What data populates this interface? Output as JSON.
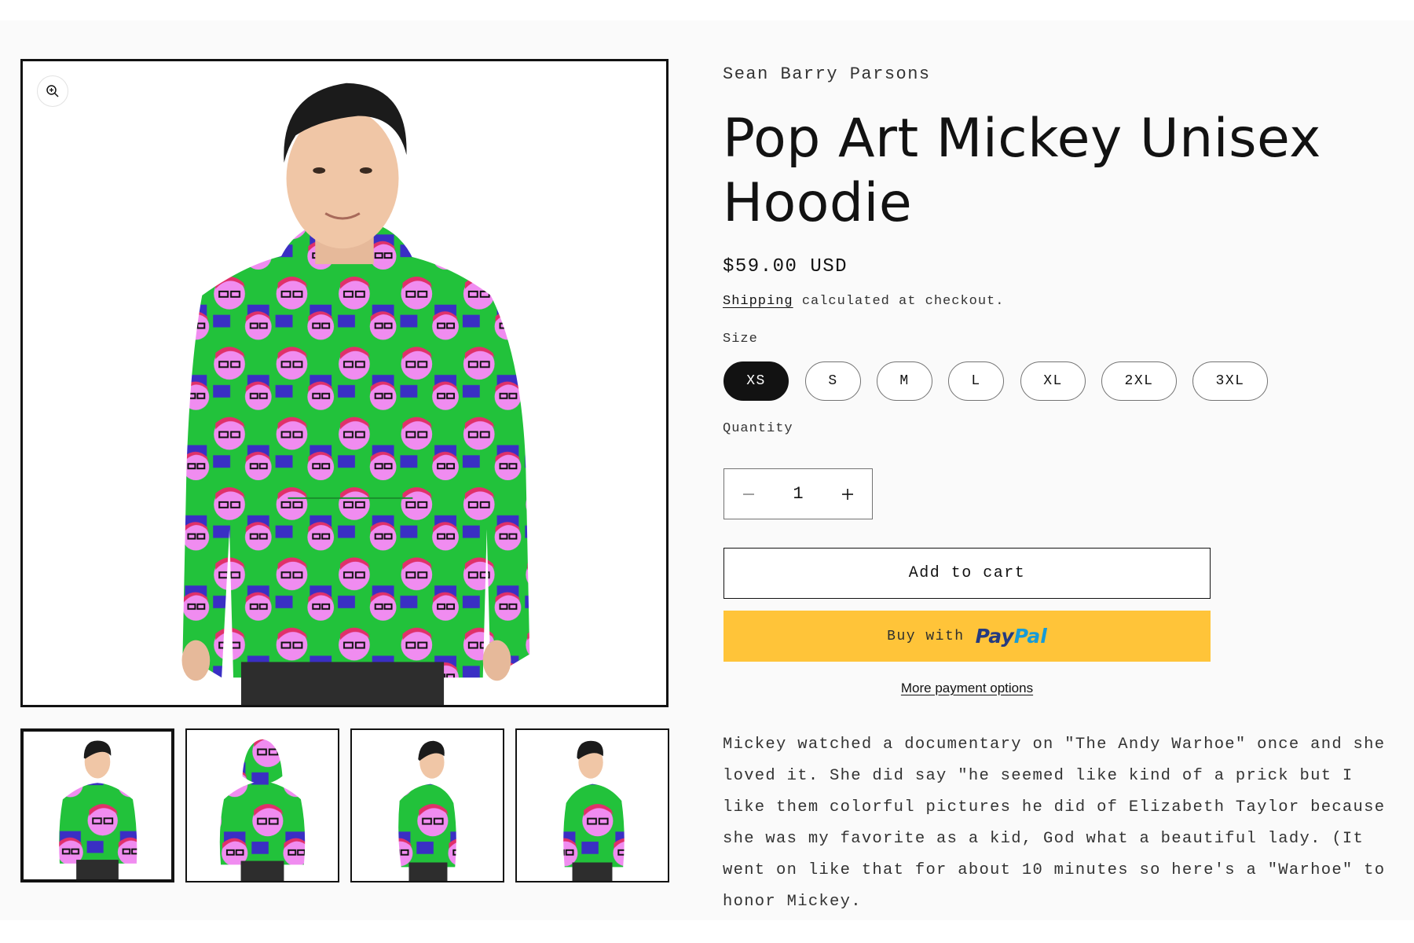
{
  "product": {
    "vendor": "Sean Barry Parsons",
    "title": "Pop Art Mickey Unisex Hoodie",
    "price": "$59.00 USD",
    "shipping_link": "Shipping",
    "shipping_rest": " calculated at checkout.",
    "size_label": "Size",
    "sizes": [
      "XS",
      "S",
      "M",
      "L",
      "XL",
      "2XL",
      "3XL"
    ],
    "selected_size": "XS",
    "quantity_label": "Quantity",
    "quantity": "1",
    "add_to_cart": "Add to cart",
    "paypal_buy": "Buy with",
    "paypal_logo": "PayPal",
    "more_payment": "More payment options",
    "description": "Mickey watched a documentary on \"The Andy Warhoe\" once and she loved it. She did say \"he seemed like kind of a prick but I like them colorful pictures he did of Elizabeth Taylor because she was my favorite as a kid, God what a beautiful lady. (It went on like that for about 10 minutes so here's a \"Warhoe\" to honor Mickey."
  },
  "gallery": {
    "thumbnails": [
      "front",
      "back",
      "side-left",
      "side-right"
    ],
    "active_thumbnail": 0
  },
  "icons": {
    "zoom": "zoom-in-icon",
    "minus": "minus-icon",
    "plus": "plus-icon"
  },
  "colors": {
    "hoodie_green": "#22c23b",
    "hoodie_pink": "#f08cf0",
    "paypal_yellow": "#ffc439",
    "selected_pill": "#121212"
  }
}
